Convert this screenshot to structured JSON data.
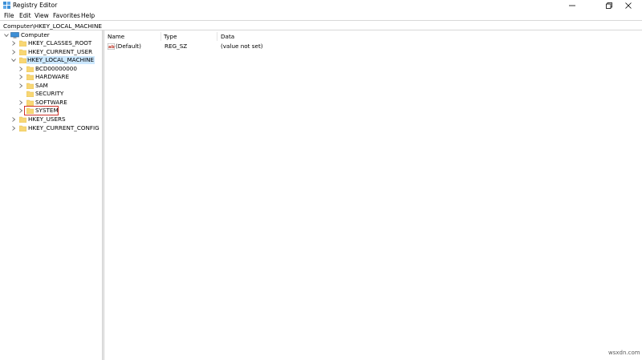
{
  "window": {
    "title": "Registry Editor",
    "app_icon": "registry-editor-icon",
    "controls": [
      "minimize-icon",
      "maximize-icon",
      "close-icon"
    ]
  },
  "menu": {
    "file": "File",
    "edit": "Edit",
    "view": "View",
    "favorites": "Favorites",
    "help": "Help"
  },
  "address": {
    "path": "Computer\\HKEY_LOCAL_MACHINE"
  },
  "tree": {
    "computer": "Computer",
    "classes_root": "HKEY_CLASSES_ROOT",
    "current_user": "HKEY_CURRENT_USER",
    "local_machine": "HKEY_LOCAL_MACHINE",
    "bcd": "BCD00000000",
    "hardware": "HARDWARE",
    "sam": "SAM",
    "security": "SECURITY",
    "software": "SOFTWARE",
    "system": "SYSTEM",
    "users": "HKEY_USERS",
    "current_config": "HKEY_CURRENT_CONFIG",
    "selected": "HKEY_LOCAL_MACHINE",
    "highlighted": "SYSTEM"
  },
  "values_pane": {
    "headers": {
      "name": "Name",
      "type": "Type",
      "data": "Data"
    },
    "rows": [
      {
        "name": "(Default)",
        "type": "REG_SZ",
        "data": "(value not set)"
      }
    ]
  },
  "watermark": "wsxdn.com",
  "colors": {
    "folder": "#f8d775",
    "folder_dark": "#e0b84a",
    "selection": "#cce8ff",
    "highlight_box": "#d0342c",
    "monitor_blue": "#3c8fd6",
    "reg_sz_red": "#c0392b"
  }
}
